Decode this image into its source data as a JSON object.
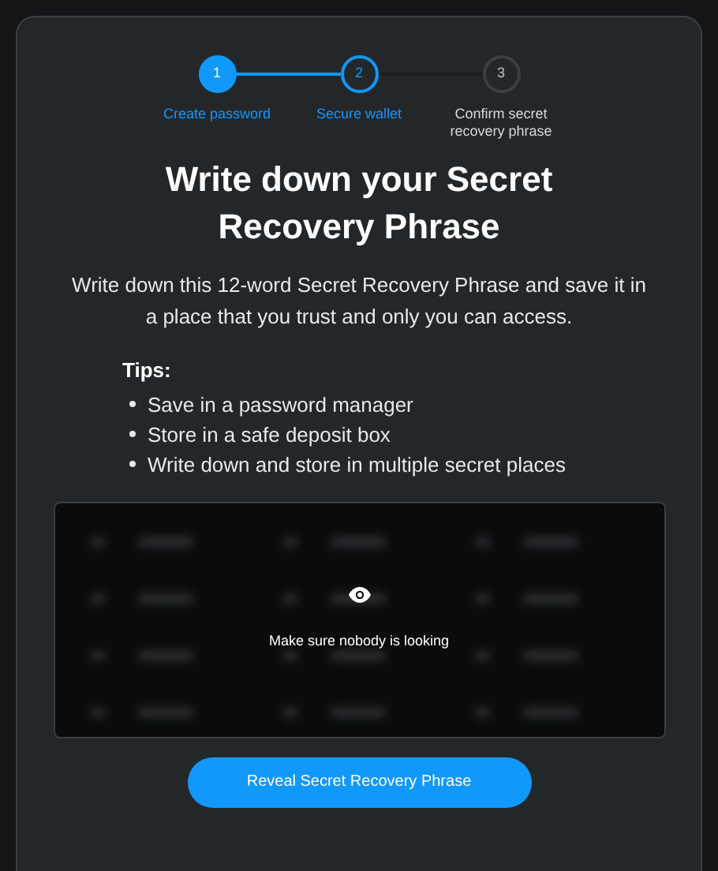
{
  "steps": [
    {
      "number": "1",
      "label": "Create password",
      "kind": "complete"
    },
    {
      "number": "2",
      "label": "Secure wallet",
      "kind": "active"
    },
    {
      "number": "3",
      "label": "Confirm secret recovery phrase",
      "kind": "pending"
    }
  ],
  "title": "Write down your Secret Recovery Phrase",
  "description": "Write down this 12-word Secret Recovery Phrase and save it in a place that you trust and only you can access.",
  "tips": {
    "heading": "Tips:",
    "items": [
      "Save in a password manager",
      "Store in a safe deposit box",
      "Write down and store in multiple secret places"
    ]
  },
  "phrase_box": {
    "hidden": true,
    "message": "Make sure nobody is looking"
  },
  "button": "Reveal Secret Recovery Phrase"
}
